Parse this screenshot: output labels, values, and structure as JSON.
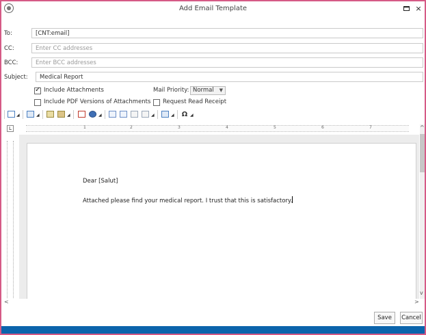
{
  "window": {
    "title": "Add Email Template",
    "border_color": "#d55a86",
    "status_bar_color": "#0b64ac"
  },
  "controls": {
    "maximize_icon": "maximize-icon",
    "close_label": "×"
  },
  "fields": {
    "to": {
      "label": "To:",
      "value": "[CNT:email]"
    },
    "cc": {
      "label": "CC:",
      "placeholder": "Enter CC addresses"
    },
    "bcc": {
      "label": "BCC:",
      "placeholder": "Enter BCC addresses"
    },
    "subject": {
      "label": "Subject:",
      "value": "Medical Report"
    }
  },
  "options": {
    "include_attachments": {
      "label": "Include Attachments",
      "checked": true
    },
    "include_pdf": {
      "label": "Include PDF Versions of Attachments",
      "checked": false
    },
    "mail_priority": {
      "label": "Mail Priority:",
      "value": "Normal"
    },
    "request_read_receipt": {
      "label": "Request Read Receipt",
      "checked": false
    }
  },
  "toolbar": {
    "icons": [
      "table-icon",
      "picture-icon",
      "image-icon",
      "bookmark-icon",
      "hyperlink-icon",
      "header-icon",
      "footer-icon",
      "page-number-icon",
      "date-icon",
      "textbox-icon",
      "symbol-icon"
    ],
    "symbol_glyph": "Ω"
  },
  "ruler": {
    "numbers": [
      "1",
      "2",
      "3",
      "4",
      "5",
      "6",
      "7"
    ]
  },
  "document": {
    "lines": [
      "Dear [Salut]",
      "Attached please find your medical report.  I trust that this is satisfactory."
    ]
  },
  "buttons": {
    "save": "Save",
    "cancel": "Cancel"
  }
}
